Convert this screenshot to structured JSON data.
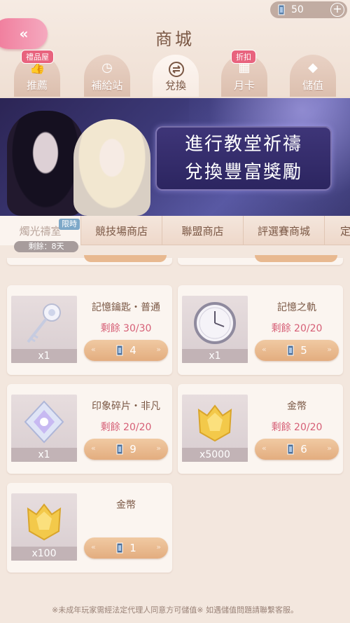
{
  "header": {
    "title": "商城",
    "currency": {
      "icon": "gem-icon",
      "amount": "50"
    }
  },
  "tabs": [
    {
      "label": "推薦",
      "icon": "thumbs-up-icon",
      "badge": "禮品屋"
    },
    {
      "label": "補給站",
      "icon": "supply-clock-icon",
      "badge": ""
    },
    {
      "label": "兌換",
      "icon": "exchange-icon",
      "badge": "",
      "active": true
    },
    {
      "label": "月卡",
      "icon": "calendar-icon",
      "badge": "折扣"
    },
    {
      "label": "儲值",
      "icon": "diamond-icon",
      "badge": ""
    }
  ],
  "banner": {
    "line1": "進行教堂祈禱",
    "line2": "兌換豐富獎勵"
  },
  "subtabs": {
    "items": [
      "燭光禱室",
      "競技場商店",
      "聯盟商店",
      "評選賽商城",
      "定"
    ],
    "limit_badge": "限時",
    "remaining": "剩餘：8天"
  },
  "items": [
    {
      "name": "記憶鑰匙・普通",
      "remaining": "剩餘 30/30",
      "qty": "x1",
      "price": "4",
      "art": "memory-key-art"
    },
    {
      "name": "記憶之軌",
      "remaining": "剩餘 20/20",
      "qty": "x1",
      "price": "5",
      "art": "clock-art"
    },
    {
      "name": "印象碎片・非凡",
      "remaining": "剩餘 20/20",
      "qty": "x1",
      "price": "9",
      "art": "crystal-shard-art"
    },
    {
      "name": "金幣",
      "remaining": "剩餘 20/20",
      "qty": "x5000",
      "price": "6",
      "art": "gold-coin-art"
    },
    {
      "name": "金幣",
      "remaining": "",
      "qty": "x100",
      "price": "1",
      "art": "gold-coin-art"
    }
  ],
  "footer": "※未成年玩家需經法定代理人同意方可儲值※ 如遇儲值問題請聯繫客服。"
}
